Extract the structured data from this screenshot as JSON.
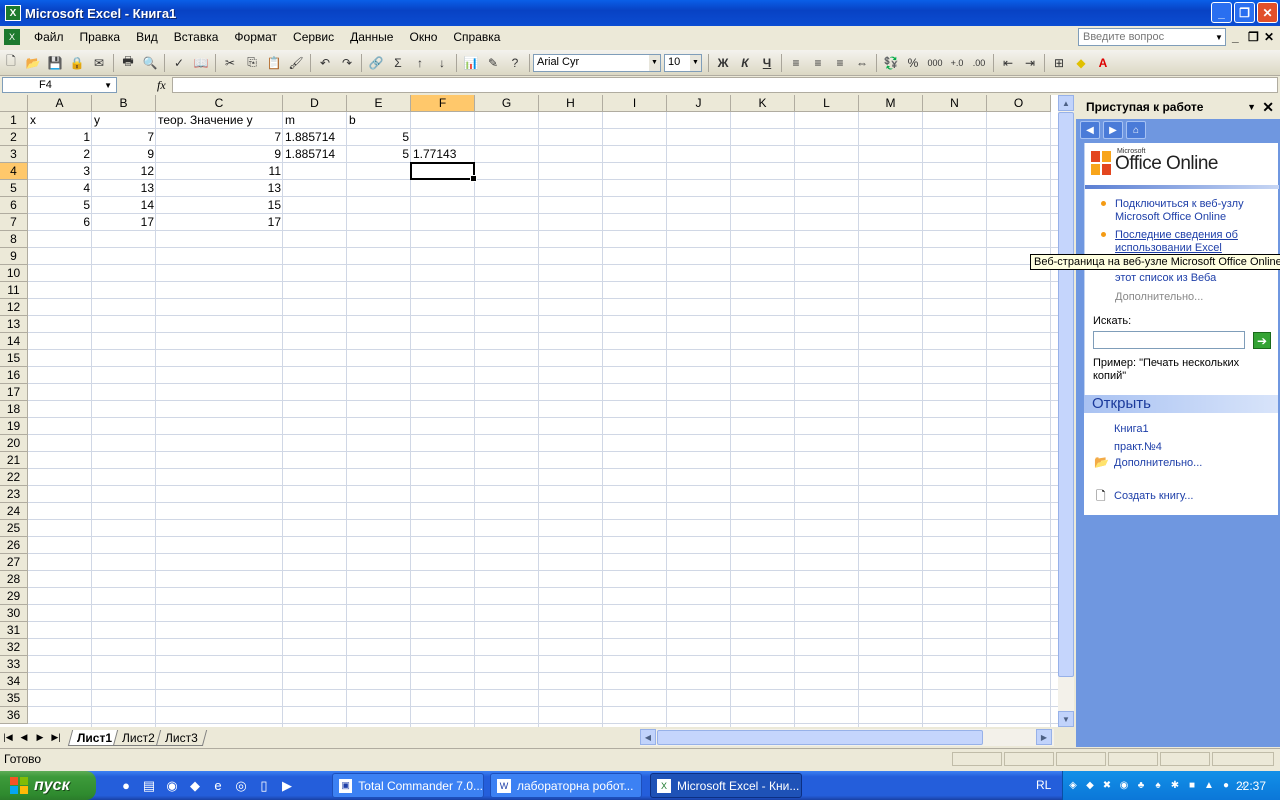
{
  "window": {
    "title": "Microsoft Excel - Книга1"
  },
  "menu": [
    "Файл",
    "Правка",
    "Вид",
    "Вставка",
    "Формат",
    "Сервис",
    "Данные",
    "Окно",
    "Справка"
  ],
  "ask_placeholder": "Введите вопрос",
  "format": {
    "font": "Arial Cyr",
    "size": "10",
    "bold": "Ж",
    "italic": "К",
    "underline": "Ч"
  },
  "namebox": "F4",
  "fx_label": "fx",
  "columns": [
    "A",
    "B",
    "C",
    "D",
    "E",
    "F",
    "G",
    "H",
    "I",
    "J",
    "K",
    "L",
    "M",
    "N",
    "O"
  ],
  "selected_col": "F",
  "rows": [
    "1",
    "2",
    "3",
    "4",
    "5",
    "6",
    "7",
    "8",
    "9",
    "10",
    "11",
    "12",
    "13",
    "14",
    "15",
    "16",
    "17",
    "18",
    "19",
    "20",
    "21",
    "22",
    "23",
    "24",
    "25",
    "26",
    "27",
    "28",
    "29",
    "30",
    "31",
    "32",
    "33",
    "34",
    "35",
    "36"
  ],
  "selected_row": "4",
  "cells": {
    "A1": "x",
    "B1": "y",
    "C1": "теор. Значение y",
    "D1": "m",
    "E1": "b",
    "A2": "1",
    "B2": "7",
    "C2": "7",
    "D2": "1.885714",
    "E2": "5",
    "A3": "2",
    "B3": "9",
    "C3": "9",
    "D3": "1.885714",
    "E3": "5",
    "F3": "1.77143",
    "A4": "3",
    "B4": "12",
    "C4": "11",
    "A5": "4",
    "B5": "13",
    "C5": "13",
    "A6": "5",
    "B6": "14",
    "C6": "15",
    "A7": "6",
    "B7": "17",
    "C7": "17"
  },
  "sheets": [
    "Лист1",
    "Лист2",
    "Лист3"
  ],
  "status": "Готово",
  "taskpane": {
    "title": "Приступая к работе",
    "office_online_brand": "Office Online",
    "office_online_ms": "Microsoft",
    "links": [
      "Подключиться к веб-узлу Microsoft Office Online",
      "Последние сведения об использовании Excel",
      "этот список из Веба"
    ],
    "more": "Дополнительно...",
    "search_label": "Искать:",
    "example": "Пример: \"Печать нескольких копий\"",
    "open_title": "Открыть",
    "open_items": [
      "Книга1",
      "практ.№4"
    ],
    "open_more": "Дополнительно...",
    "create": "Создать книгу..."
  },
  "tooltip": "Веб-страница на веб-узле Microsoft Office Online",
  "taskbar": {
    "start": "пуск",
    "tasks": [
      "Total Commander 7.0...",
      "лабораторна робот...",
      "Microsoft Excel - Кни..."
    ],
    "lang": "RL",
    "clock": "22:37"
  }
}
